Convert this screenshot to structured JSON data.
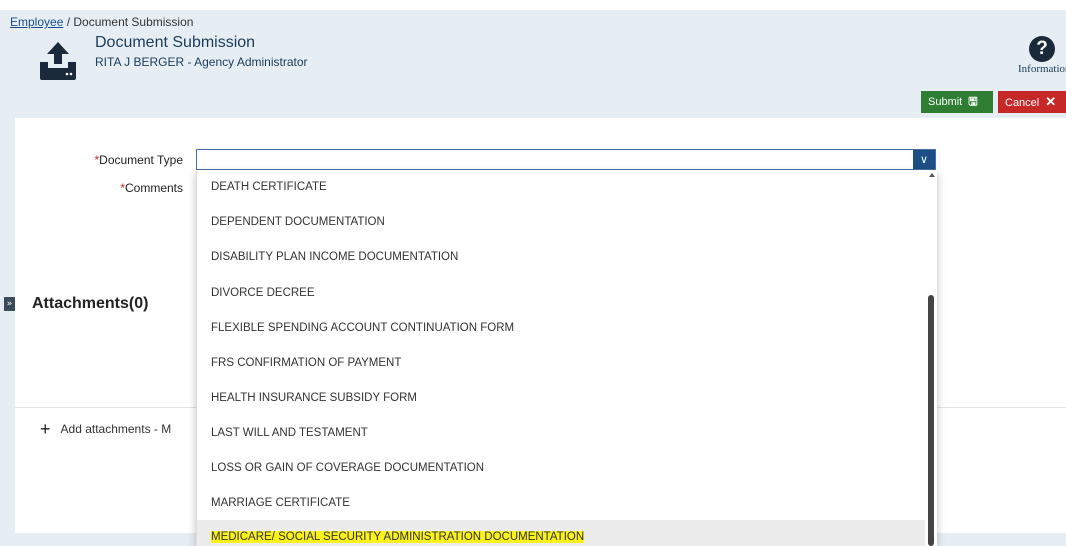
{
  "breadcrumb": {
    "link": "Employee",
    "separator": " / ",
    "current": "Document Submission"
  },
  "header": {
    "title": "Document Submission",
    "subtitle": "RITA J BERGER - Agency Administrator",
    "info_label": "Information",
    "info_glyph": "?"
  },
  "buttons": {
    "submit": "Submit",
    "submit_icon": "🖫",
    "cancel": "Cancel",
    "cancel_icon": "✕"
  },
  "form": {
    "required_mark": "*",
    "document_type_label": "Document Type",
    "comments_label": "Comments",
    "document_type_value": "",
    "select_arrow": "∨"
  },
  "attachments": {
    "title": "Attachments(0)",
    "add_label": "Add attachments - M",
    "expander": "»",
    "plus": "+"
  },
  "dropdown": {
    "options": [
      "DEATH CERTIFICATE",
      "DEPENDENT DOCUMENTATION",
      "DISABILITY PLAN INCOME DOCUMENTATION",
      "DIVORCE DECREE",
      "FLEXIBLE SPENDING ACCOUNT CONTINUATION FORM",
      "FRS CONFIRMATION OF PAYMENT",
      "HEALTH INSURANCE SUBSIDY FORM",
      "LAST WILL AND TESTAMENT",
      "LOSS OR GAIN OF COVERAGE DOCUMENTATION",
      "MARRIAGE CERTIFICATE",
      "MEDICARE/ SOCIAL SECURITY ADMINISTRATION DOCUMENTATION"
    ],
    "hovered_index": 10
  },
  "colors": {
    "accent": "#1d4f86",
    "submit": "#2e7d32",
    "cancel": "#c62828",
    "highlight": "#fbf21c"
  }
}
